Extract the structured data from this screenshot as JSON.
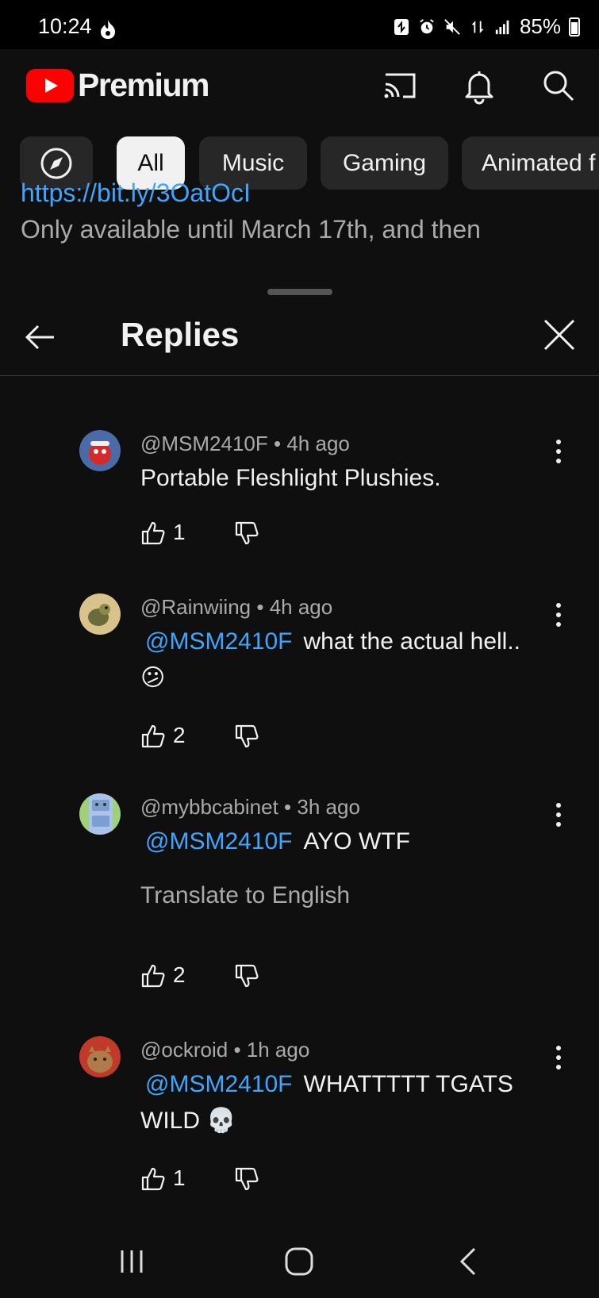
{
  "status_bar": {
    "time": "10:24",
    "battery": "85%"
  },
  "app": {
    "brand": "Premium"
  },
  "chips": [
    "All",
    "Music",
    "Gaming",
    "Animated f"
  ],
  "background": {
    "link": "https://bit.ly/3OatOcI",
    "line": "Only available until March 17th, and then"
  },
  "sheet": {
    "title": "Replies"
  },
  "replies": [
    {
      "author": "@MSM2410F",
      "time": "4h ago",
      "mention": "",
      "text": "Portable Fleshlight Plushies.",
      "likes": "1",
      "avatar_color": "#c8323a"
    },
    {
      "author": "@Rainwiing",
      "time": "4h ago",
      "mention": "@MSM2410F",
      "text": "what the actual hell..",
      "emoji": "😕",
      "likes": "2",
      "avatar_color": "#b9a46a"
    },
    {
      "author": "@mybbcabinet",
      "time": "3h ago",
      "mention": "@MSM2410F",
      "text": "AYO WTF",
      "translate": "Translate to English",
      "likes": "2",
      "avatar_color": "#8fb0d8"
    },
    {
      "author": "@ockroid",
      "time": "1h ago",
      "mention": "@MSM2410F",
      "text": "WHATTTTT TGATS WILD 💀",
      "likes": "1",
      "avatar_color": "#8a3a2a"
    }
  ],
  "colors": {
    "background": "#0f0f0f",
    "accent_link": "#3ea6ff",
    "youtube_red": "#ff0000"
  }
}
